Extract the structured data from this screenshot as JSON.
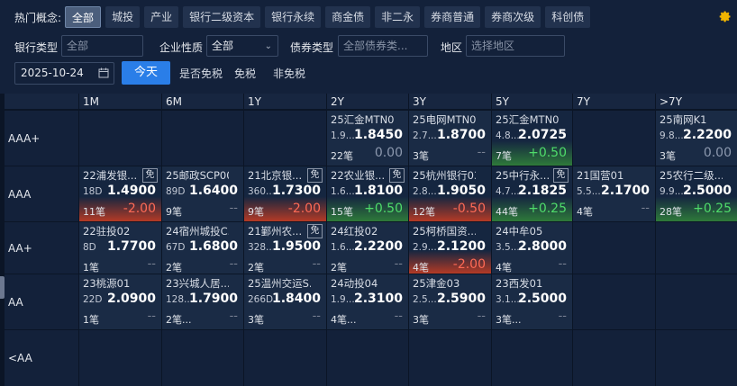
{
  "filters": {
    "hot_label": "热门概念:",
    "hot_tags": [
      "全部",
      "城投",
      "产业",
      "银行二级资本",
      "银行永续",
      "商金债",
      "非二永",
      "券商普通",
      "券商次级",
      "科创债"
    ],
    "bank_type_label": "银行类型",
    "bank_type_value": "全部",
    "corp_nature_label": "企业性质",
    "corp_nature_value": "全部",
    "bond_type_label": "债券类型",
    "bond_type_placeholder": "全部债券类...",
    "region_label": "地区",
    "region_placeholder": "选择地区",
    "date_value": "2025-10-24",
    "today_label": "今天",
    "tax_question": "是否免税",
    "tax_exempt": "免税",
    "tax_nonexempt": "非免税"
  },
  "grid": {
    "columns": [
      "1M",
      "6M",
      "1Y",
      "2Y",
      "3Y",
      "5Y",
      "7Y",
      ">7Y"
    ],
    "rows": [
      "AAA+",
      "AAA",
      "AA+",
      "AA",
      "<AA"
    ],
    "cells": [
      {
        "r": 0,
        "c": 3,
        "name": "25汇金MTN0...",
        "term": "1.9...",
        "yield": "1.8450",
        "count": "22笔",
        "change": "0.00",
        "tone": "zero",
        "style": "neu",
        "mian": ""
      },
      {
        "r": 0,
        "c": 4,
        "name": "25电网MTN0...",
        "term": "2.7...",
        "yield": "1.8700",
        "count": "3笔",
        "change": "--",
        "tone": "dash",
        "style": "neu",
        "mian": ""
      },
      {
        "r": 0,
        "c": 5,
        "name": "25汇金MTN0...",
        "term": "4.8...",
        "yield": "2.0725",
        "count": "7笔",
        "change": "+0.50",
        "tone": "pos",
        "style": "grn",
        "mian": ""
      },
      {
        "r": 0,
        "c": 7,
        "name": "25南网K1",
        "term": "9.8...",
        "yield": "2.2200",
        "count": "3笔",
        "change": "0.00",
        "tone": "zero",
        "style": "neu",
        "mian": ""
      },
      {
        "r": 1,
        "c": 0,
        "name": "22浦发银...",
        "term": "18D",
        "yield": "1.4900",
        "count": "11笔",
        "change": "-2.00",
        "tone": "neg",
        "style": "red",
        "mian": "免"
      },
      {
        "r": 1,
        "c": 1,
        "name": "25邮政SCP001",
        "term": "89D",
        "yield": "1.6400",
        "count": "9笔",
        "change": "--",
        "tone": "dash",
        "style": "neu",
        "mian": ""
      },
      {
        "r": 1,
        "c": 2,
        "name": "21北京银...",
        "term": "360...",
        "yield": "1.7300",
        "count": "9笔",
        "change": "-2.00",
        "tone": "neg",
        "style": "red",
        "mian": "免"
      },
      {
        "r": 1,
        "c": 3,
        "name": "22农业银...",
        "term": "1.6...",
        "yield": "1.8100",
        "count": "15笔",
        "change": "+0.50",
        "tone": "pos",
        "style": "grn",
        "mian": "免"
      },
      {
        "r": 1,
        "c": 4,
        "name": "25杭州银行03",
        "term": "2.8...",
        "yield": "1.9050",
        "count": "12笔",
        "change": "-0.50",
        "tone": "neg",
        "style": "red",
        "mian": ""
      },
      {
        "r": 1,
        "c": 5,
        "name": "25中行永...",
        "term": "4.7...",
        "yield": "2.1825",
        "count": "44笔",
        "change": "+0.25",
        "tone": "pos",
        "style": "grn",
        "mian": "免"
      },
      {
        "r": 1,
        "c": 6,
        "name": "21国营01",
        "term": "5.5...",
        "yield": "2.1700",
        "count": "4笔",
        "change": "--",
        "tone": "dash",
        "style": "neu",
        "mian": ""
      },
      {
        "r": 1,
        "c": 7,
        "name": "25农行二级...",
        "term": "9.9...",
        "yield": "2.5000",
        "count": "28笔",
        "change": "+0.25",
        "tone": "pos",
        "style": "grn",
        "mian": ""
      },
      {
        "r": 2,
        "c": 0,
        "name": "22驻投02",
        "term": "8D",
        "yield": "1.7700",
        "count": "1笔",
        "change": "--",
        "tone": "dash",
        "style": "neu",
        "mian": ""
      },
      {
        "r": 2,
        "c": 1,
        "name": "24宿州城投C...",
        "term": "67D",
        "yield": "1.6800",
        "count": "2笔",
        "change": "--",
        "tone": "dash",
        "style": "neu",
        "mian": ""
      },
      {
        "r": 2,
        "c": 2,
        "name": "21鄞州农...",
        "term": "328...",
        "yield": "1.9500",
        "count": "2笔",
        "change": "--",
        "tone": "dash",
        "style": "neu",
        "mian": "免"
      },
      {
        "r": 2,
        "c": 3,
        "name": "24红投02",
        "term": "1.6...",
        "yield": "2.2200",
        "count": "2笔",
        "change": "--",
        "tone": "dash",
        "style": "neu",
        "mian": ""
      },
      {
        "r": 2,
        "c": 4,
        "name": "25柯桥国资...",
        "term": "2.9...",
        "yield": "2.1200",
        "count": "4笔",
        "change": "-2.00",
        "tone": "neg",
        "style": "red",
        "mian": ""
      },
      {
        "r": 2,
        "c": 5,
        "name": "24中牟05",
        "term": "3.5...",
        "yield": "2.8000",
        "count": "4笔",
        "change": "--",
        "tone": "dash",
        "style": "neu",
        "mian": ""
      },
      {
        "r": 3,
        "c": 0,
        "name": "23桃源01",
        "term": "22D",
        "yield": "2.0900",
        "count": "1笔",
        "change": "--",
        "tone": "dash",
        "style": "neu",
        "mian": ""
      },
      {
        "r": 3,
        "c": 1,
        "name": "23兴城人居...",
        "term": "128...",
        "yield": "1.7900",
        "count": "2笔...",
        "change": "--",
        "tone": "dash",
        "style": "neu",
        "mian": ""
      },
      {
        "r": 3,
        "c": 2,
        "name": "25温州交运S...",
        "term": "266D",
        "yield": "1.8400",
        "count": "3笔",
        "change": "--",
        "tone": "dash",
        "style": "neu",
        "mian": ""
      },
      {
        "r": 3,
        "c": 3,
        "name": "24动投04",
        "term": "1.9...",
        "yield": "2.3100",
        "count": "4笔...",
        "change": "--",
        "tone": "dash",
        "style": "neu",
        "mian": ""
      },
      {
        "r": 3,
        "c": 4,
        "name": "25津金03",
        "term": "2.5...",
        "yield": "2.5900",
        "count": "3笔",
        "change": "--",
        "tone": "dash",
        "style": "neu",
        "mian": ""
      },
      {
        "r": 3,
        "c": 5,
        "name": "23西发01",
        "term": "3.1...",
        "yield": "2.5000",
        "count": "3笔...",
        "change": "--",
        "tone": "dash",
        "style": "neu",
        "mian": ""
      }
    ]
  }
}
